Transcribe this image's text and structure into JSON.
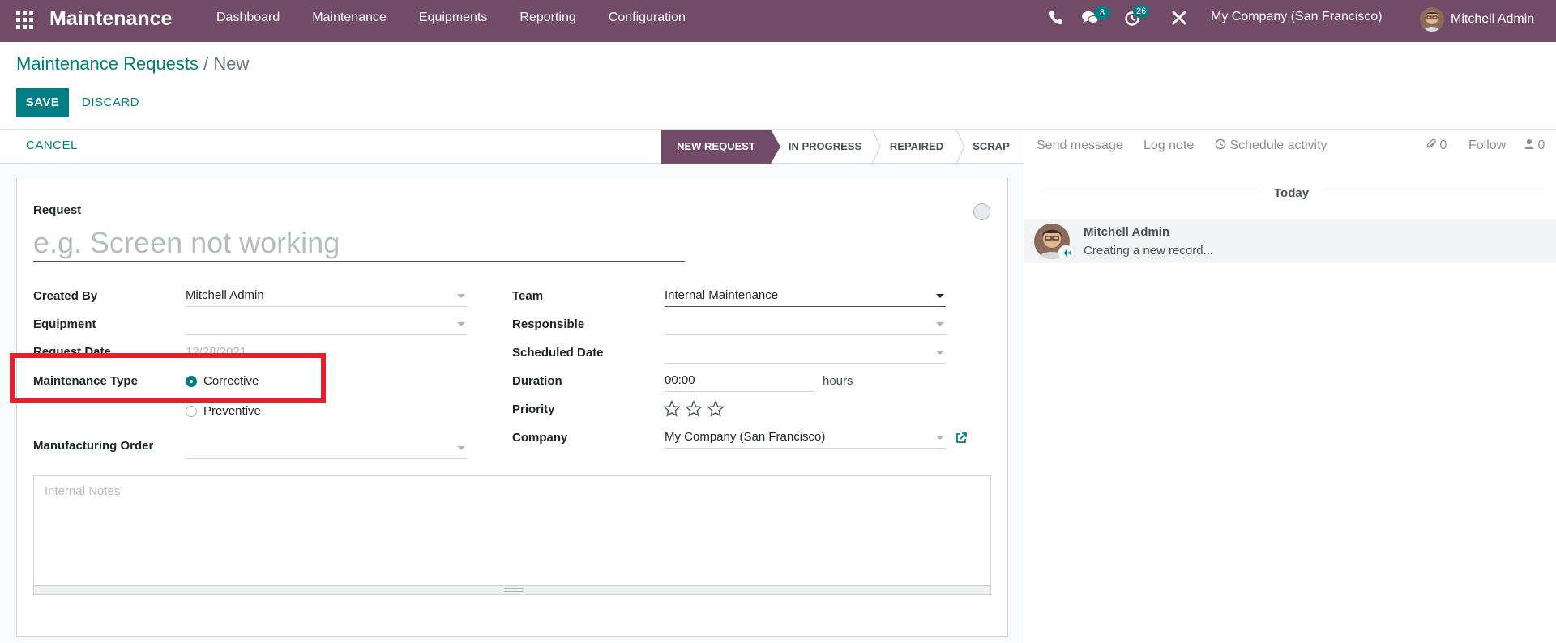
{
  "navbar": {
    "brand": "Maintenance",
    "menu": [
      "Dashboard",
      "Maintenance",
      "Equipments",
      "Reporting",
      "Configuration"
    ],
    "messages_badge": "8",
    "activities_badge": "26",
    "company": "My Company (San Francisco)",
    "user": "Mitchell Admin",
    "icons": [
      "apps-icon",
      "phone-icon",
      "chat-icon",
      "clock-icon",
      "tools-icon"
    ]
  },
  "breadcrumb": {
    "parent": "Maintenance Requests",
    "separator": "/",
    "current": "New"
  },
  "buttons": {
    "save": "SAVE",
    "discard": "DISCARD",
    "cancel": "CANCEL"
  },
  "stages": [
    "NEW REQUEST",
    "IN PROGRESS",
    "REPAIRED",
    "SCRAP"
  ],
  "active_stage": "NEW REQUEST",
  "form": {
    "request_label": "Request",
    "request_placeholder": "e.g. Screen not working",
    "created_by_label": "Created By",
    "created_by_value": "Mitchell Admin",
    "equipment_label": "Equipment",
    "equipment_value": "",
    "request_date_label": "Request Date",
    "request_date_value": "12/28/2021",
    "maintenance_type_label": "Maintenance Type",
    "maintenance_type_options": [
      "Corrective",
      "Preventive"
    ],
    "maintenance_type_selected": "Corrective",
    "manufacturing_order_label": "Manufacturing Order",
    "manufacturing_order_value": "",
    "team_label": "Team",
    "team_value": "Internal Maintenance",
    "responsible_label": "Responsible",
    "responsible_value": "",
    "scheduled_date_label": "Scheduled Date",
    "scheduled_date_value": "",
    "duration_label": "Duration",
    "duration_value": "00:00",
    "duration_unit": "hours",
    "priority_label": "Priority",
    "priority_stars": 0,
    "priority_max": 3,
    "company_label": "Company",
    "company_value": "My Company (San Francisco)",
    "notes_placeholder": "Internal Notes"
  },
  "chatter": {
    "send_message": "Send message",
    "log_note": "Log note",
    "schedule_activity": "Schedule activity",
    "attachments_count": "0",
    "follow": "Follow",
    "followers_count": "0",
    "date_separator": "Today",
    "messages": [
      {
        "author": "Mitchell Admin",
        "body": "Creating a new record..."
      }
    ]
  },
  "colors": {
    "brand": "#714B67",
    "accent": "#017E84",
    "highlight": "#e3202c"
  }
}
